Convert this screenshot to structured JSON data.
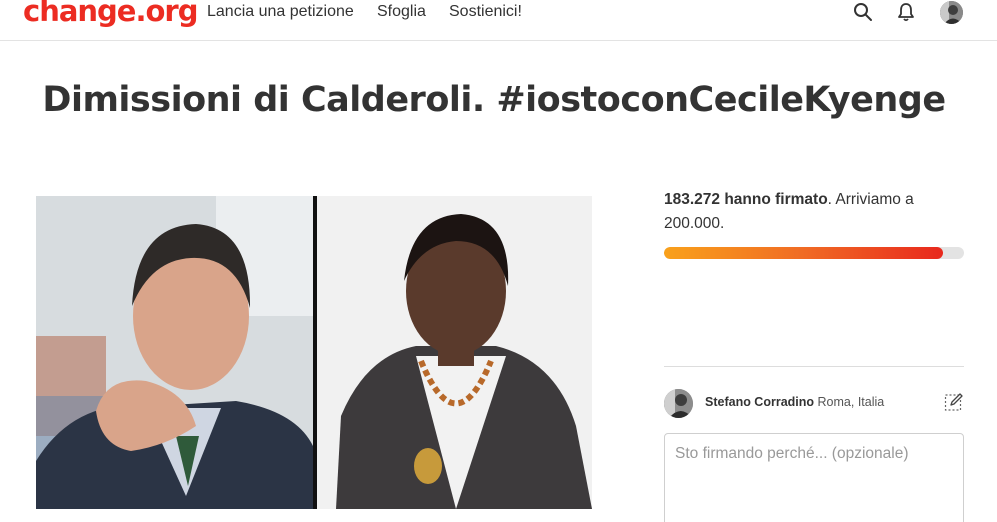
{
  "header": {
    "logo": "change.org",
    "nav": [
      "Lancia una petizione",
      "Sfoglia",
      "Sostienici!"
    ],
    "icons": [
      "search-icon",
      "bell-icon",
      "user-avatar"
    ]
  },
  "petition": {
    "title": "Dimissioni di Calderoli. #iostoconCecileKyenge",
    "signatures": {
      "count_text": "183.272 hanno firmato",
      "goal_text": ". Arriviamo a 200.000.",
      "count": 183272,
      "goal": 200000,
      "progress_fraction": 0.93
    }
  },
  "signer": {
    "name": "Stefano Corradino",
    "location": "Roma, Italia"
  },
  "comment": {
    "placeholder": "Sto firmando perché... (opzionale)"
  },
  "colors": {
    "brand": "#ec2c22",
    "progress_start": "#f9a11b",
    "progress_end": "#e8281d"
  }
}
